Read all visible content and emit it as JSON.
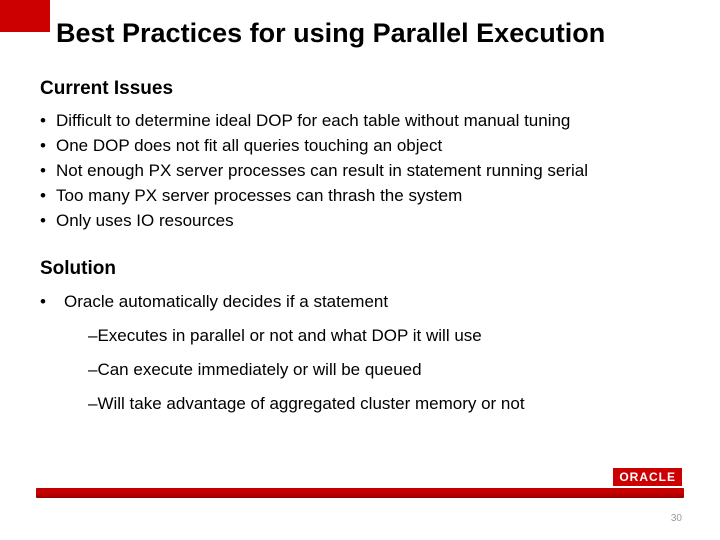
{
  "title": "Best Practices for using Parallel Execution",
  "section1_heading": "Current Issues",
  "issues": [
    "Difficult to determine ideal DOP for each table without manual tuning",
    "One DOP does not fit all queries touching an object",
    "Not enough PX server processes can result in statement running serial",
    "Too many PX server processes can thrash the system",
    "Only uses IO resources"
  ],
  "section2_heading": "Solution",
  "solution_lead": "Oracle automatically decides if a statement",
  "solution_subs": [
    "–Executes in parallel or not and what DOP it will use",
    "–Can execute immediately or will be queued",
    "–Will take advantage of aggregated cluster memory or not"
  ],
  "logo_text": "ORACLE",
  "page_number": "30"
}
